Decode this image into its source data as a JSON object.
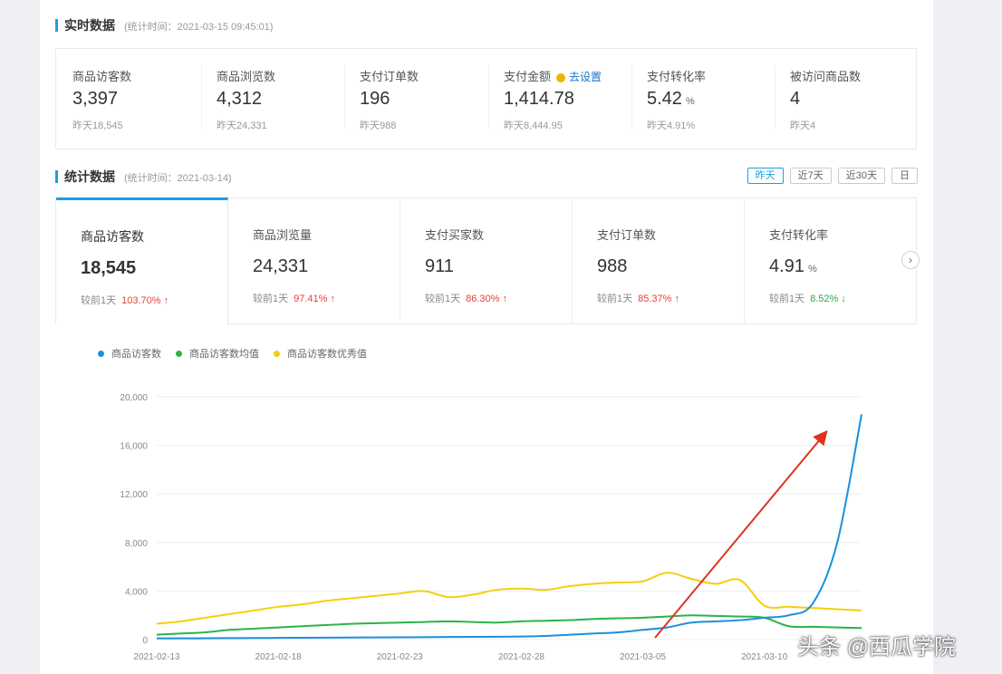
{
  "realtime": {
    "title": "实时数据",
    "subtitle": "(统计时间：2021-03-15 09:45:01)",
    "cards": [
      {
        "label": "商品访客数",
        "value": "3,397",
        "unit": "",
        "compare": "昨天18,545"
      },
      {
        "label": "商品浏览数",
        "value": "4,312",
        "unit": "",
        "compare": "昨天24,331"
      },
      {
        "label": "支付订单数",
        "value": "196",
        "unit": "",
        "compare": "昨天988"
      },
      {
        "label": "支付金额",
        "value": "1,414.78",
        "unit": "",
        "compare": "昨天8,444.95",
        "link": "去设置"
      },
      {
        "label": "支付转化率",
        "value": "5.42",
        "unit": "%",
        "compare": "昨天4.91%"
      },
      {
        "label": "被访问商品数",
        "value": "4",
        "unit": "",
        "compare": "昨天4"
      }
    ]
  },
  "stats": {
    "title": "统计数据",
    "subtitle": "(统计时间：2021-03-14)",
    "ranges": [
      "昨天",
      "近7天",
      "近30天",
      "日"
    ],
    "active_range": 0,
    "cards": [
      {
        "label": "商品访客数",
        "value": "18,545",
        "unit": "",
        "compare_label": "较前1天",
        "change": "103.70%",
        "direction": "up"
      },
      {
        "label": "商品浏览量",
        "value": "24,331",
        "unit": "",
        "compare_label": "较前1天",
        "change": "97.41%",
        "direction": "up"
      },
      {
        "label": "支付买家数",
        "value": "911",
        "unit": "",
        "compare_label": "较前1天",
        "change": "86.30%",
        "direction": "up"
      },
      {
        "label": "支付订单数",
        "value": "988",
        "unit": "",
        "compare_label": "较前1天",
        "change": "85.37%",
        "direction": "up"
      },
      {
        "label": "支付转化率",
        "value": "4.91",
        "unit": "%",
        "compare_label": "较前1天",
        "change": "8.52%",
        "direction": "down"
      }
    ],
    "next_icon": "chevron-right-icon"
  },
  "chart_data": {
    "type": "line",
    "x": [
      "2021-02-13",
      "2021-02-14",
      "2021-02-15",
      "2021-02-16",
      "2021-02-17",
      "2021-02-18",
      "2021-02-19",
      "2021-02-20",
      "2021-02-21",
      "2021-02-22",
      "2021-02-23",
      "2021-02-24",
      "2021-02-25",
      "2021-02-26",
      "2021-02-27",
      "2021-02-28",
      "2021-03-01",
      "2021-03-02",
      "2021-03-03",
      "2021-03-04",
      "2021-03-05",
      "2021-03-06",
      "2021-03-07",
      "2021-03-08",
      "2021-03-09",
      "2021-03-10",
      "2021-03-11",
      "2021-03-12",
      "2021-03-13",
      "2021-03-14"
    ],
    "xticks": [
      "2021-02-13",
      "2021-02-18",
      "2021-02-23",
      "2021-02-28",
      "2021-03-05",
      "2021-03-10"
    ],
    "yticks": [
      0,
      4000,
      8000,
      12000,
      16000,
      20000
    ],
    "ytick_labels": [
      "0",
      "4,000",
      "8,000",
      "12,000",
      "16,000",
      "20,000"
    ],
    "ylim": [
      0,
      20000
    ],
    "series": [
      {
        "name": "商品访客数",
        "color": "#1a8fe0",
        "values": [
          100,
          100,
          110,
          120,
          130,
          140,
          150,
          160,
          170,
          180,
          190,
          200,
          210,
          220,
          230,
          250,
          300,
          400,
          500,
          600,
          800,
          1000,
          1400,
          1500,
          1600,
          1800,
          2000,
          3000,
          8000,
          18545
        ]
      },
      {
        "name": "商品访客数均值",
        "color": "#2bb34a",
        "values": [
          400,
          500,
          600,
          800,
          900,
          1000,
          1100,
          1200,
          1300,
          1350,
          1400,
          1450,
          1500,
          1450,
          1400,
          1500,
          1550,
          1600,
          1700,
          1750,
          1800,
          1900,
          2000,
          1950,
          1900,
          1800,
          1100,
          1050,
          1000,
          950
        ]
      },
      {
        "name": "商品访客数优秀值",
        "color": "#f2d00e",
        "values": [
          1300,
          1500,
          1800,
          2100,
          2400,
          2700,
          2900,
          3200,
          3400,
          3600,
          3800,
          4000,
          3500,
          3700,
          4100,
          4200,
          4100,
          4400,
          4600,
          4700,
          4800,
          5500,
          5000,
          4600,
          4900,
          2800,
          2700,
          2600,
          2500,
          2400
        ]
      }
    ]
  },
  "watermark": "头条 @西瓜学院"
}
